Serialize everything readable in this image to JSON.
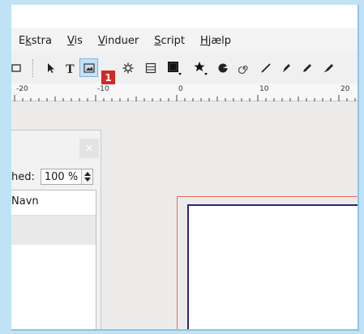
{
  "menu": [
    {
      "pre": "E",
      "u": "k",
      "post": "stra"
    },
    {
      "pre": "",
      "u": "V",
      "post": "is"
    },
    {
      "pre": "",
      "u": "V",
      "post": "induer"
    },
    {
      "pre": "",
      "u": "S",
      "post": "cript"
    },
    {
      "pre": "",
      "u": "H",
      "post": "jælp"
    }
  ],
  "callout_label": "1",
  "ruler_labels": [
    "-20",
    "-10",
    "0",
    "10",
    "20"
  ],
  "zoom": {
    "label": "hed:",
    "value": "100 %"
  },
  "layers": {
    "column_header": "Navn"
  },
  "colors": {
    "accent_callout": "#d42727",
    "page_border": "#2a2578",
    "bleed_border": "#e06a5a"
  }
}
